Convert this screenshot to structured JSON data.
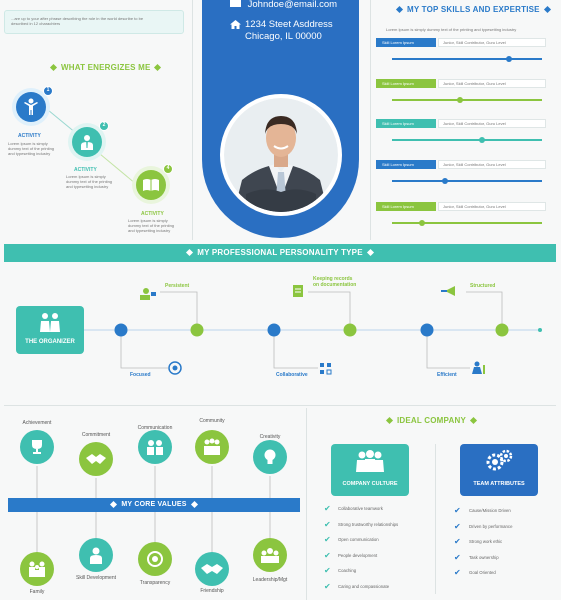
{
  "intro_box": {
    "text_line1": "...are up to your after phrase describing the role in the world describe to be",
    "text_line2": "described in 12 charachters"
  },
  "contact": {
    "email": "Johndoe@email.com",
    "address_line1": "1234 Steet Asddress",
    "address_line2": "Chicago, IL 00000"
  },
  "energizes": {
    "title": "WHAT ENERGIZES ME",
    "items": [
      {
        "number": "1",
        "label": "ACTIVITY",
        "desc": [
          "Lorem Ipsum is simply",
          "dummy text of the printing",
          "and typesetting industry"
        ]
      },
      {
        "number": "2",
        "label": "ACTIVITY",
        "desc": [
          "Lorem Ipsum is simply",
          "dummy text of the printing",
          "and typesetting industry"
        ]
      },
      {
        "number": "4",
        "label": "ACTIVITY",
        "desc": [
          "Lorem Ipsum is simply",
          "dummy text of the printing",
          "and typesetting industry"
        ]
      }
    ]
  },
  "skills": {
    "title": "MY TOP SKILLS AND EXPERTISE",
    "intro": "Lorem Ipsum is simply dummy text of the printing and typesetting industry",
    "rows": [
      {
        "tag": "Skill Lorem Ipsum",
        "levels": "Junior, Skill Contributor, Guru Level",
        "level": 0.78,
        "color": "#2a7ac9"
      },
      {
        "tag": "Skill Lorem Ipsum",
        "levels": "Junior, Skill Contributor, Guru Level",
        "level": 0.45,
        "color": "#8bc53f"
      },
      {
        "tag": "Skill Lorem Ipsum",
        "levels": "Junior, Skill Contributor, Guru Level",
        "level": 0.6,
        "color": "#3fbfb0"
      },
      {
        "tag": "Skill Lorem Ipsum",
        "levels": "Junior, Skill Contributor, Guru Level",
        "level": 0.35,
        "color": "#2a7ac9"
      },
      {
        "tag": "Skill Lorem Ipsum",
        "levels": "Junior, Skill Contributor, Guru Level",
        "level": 0.2,
        "color": "#8bc53f"
      }
    ]
  },
  "personality": {
    "title": "MY PROFESSIONAL PERSONALITY TYPE",
    "type_label": "THE ORGANIZER",
    "top_traits": [
      "Persistent",
      "Keeping records\non documentation",
      "Structured"
    ],
    "bottom_traits": [
      "Focused",
      "Collaborative",
      "Efficient"
    ]
  },
  "core_values": {
    "title": "MY CORE VALUES",
    "top": [
      "Achievement",
      "Commitment",
      "Communication",
      "Community",
      "Creativity"
    ],
    "bottom": [
      "Family",
      "Skill Development",
      "Transparency",
      "Friendship",
      "Leadership/Mgt"
    ]
  },
  "ideal_company": {
    "title": "IDEAL COMPANY",
    "culture_label": "COMPANY CULTURE",
    "team_label": "TEAM ATTRIBUTES",
    "culture_items": [
      "Collaborative teamwork",
      "Strong trustworthy relationships",
      "Open communication",
      "People development",
      "Coaching",
      "Caring and compassionate"
    ],
    "team_items": [
      "Cause/Mission Driven",
      "Driven by performance",
      "Strong work ethic",
      "Task ownership",
      "Goal Oriented"
    ]
  },
  "colors": {
    "blue": "#2a7ac9",
    "green": "#8bc53f",
    "teal": "#3fbfb0"
  }
}
